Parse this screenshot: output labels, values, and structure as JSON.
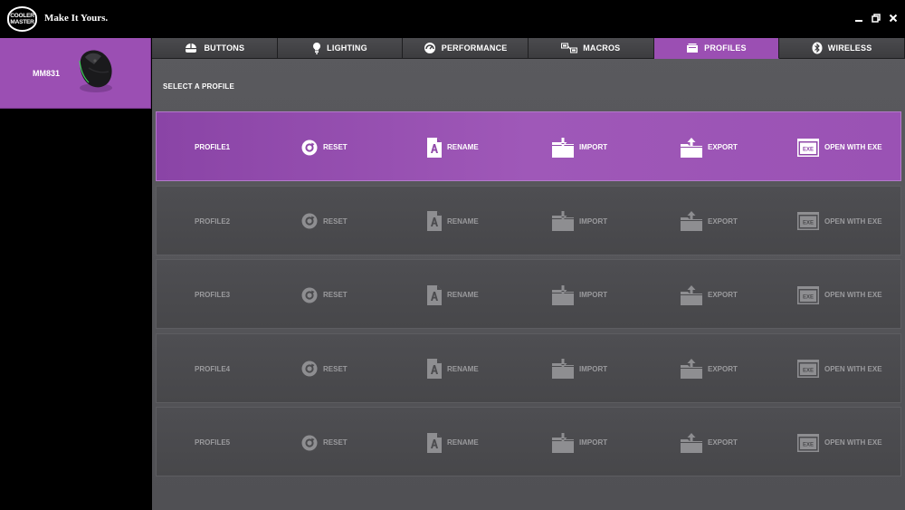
{
  "brand": {
    "logo_line1": "COOLER",
    "logo_line2": "MASTER",
    "tagline": "Make It Yours."
  },
  "device": {
    "name": "MM831"
  },
  "tabs": [
    {
      "label": "BUTTONS",
      "icon": "mouse-icon",
      "active": false
    },
    {
      "label": "LIGHTING",
      "icon": "bulb-icon",
      "active": false
    },
    {
      "label": "PERFORMANCE",
      "icon": "gauge-icon",
      "active": false
    },
    {
      "label": "MACROS",
      "icon": "macro-icon",
      "active": false
    },
    {
      "label": "PROFILES",
      "icon": "profile-icon",
      "active": true
    },
    {
      "label": "WIRELESS",
      "icon": "bluetooth-icon",
      "active": false
    }
  ],
  "section_title": "SELECT A PROFILE",
  "actions": {
    "reset": "RESET",
    "rename": "RENAME",
    "import": "IMPORT",
    "export": "EXPORT",
    "open_exe": "OPEN WITH EXE",
    "exe_badge": "EXE"
  },
  "profiles": [
    {
      "name": "PROFILE1",
      "active": true
    },
    {
      "name": "PROFILE2",
      "active": false
    },
    {
      "name": "PROFILE3",
      "active": false
    },
    {
      "name": "PROFILE4",
      "active": false
    },
    {
      "name": "PROFILE5",
      "active": false
    }
  ],
  "colors": {
    "accent": "#9b4fb3",
    "tab_bg": "#434346",
    "panel_bg": "#545458",
    "inactive_text": "#9a9a9d"
  }
}
